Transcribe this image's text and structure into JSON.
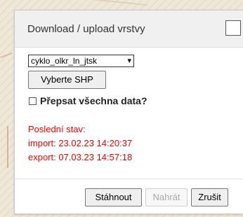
{
  "dialog": {
    "title": "Download / upload vrstvy",
    "layer_select": {
      "selected": "cyklo_olkr_ln_jtsk"
    },
    "choose_shp_label": "Vyberte SHP",
    "overwrite_label": "Přepsat všechna data?",
    "overwrite_checked": false,
    "status": {
      "heading": "Poslední stav:",
      "import": "import: 23.02.23 14:20:37",
      "export": "export: 07.03.23 14:57:18"
    },
    "buttons": {
      "download": "Stáhnout",
      "upload": "Nahrát",
      "cancel": "Zrušit"
    },
    "colors": {
      "status_text": "#ff0000",
      "header_bg": "#f0f0f0"
    }
  }
}
